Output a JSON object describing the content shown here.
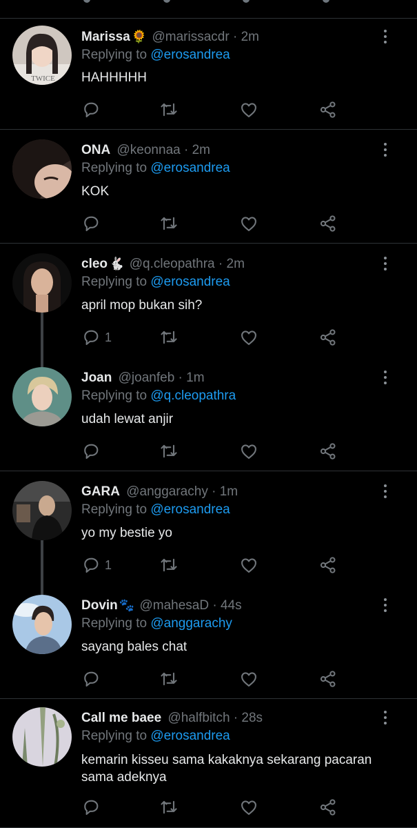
{
  "tweets": [
    {
      "name": "Marissa",
      "emoji": "🌻",
      "handle": "@marissacdr",
      "time": "2m",
      "replying_prefix": "Replying to",
      "replying_to": "@erosandrea",
      "lines": [
        "HAHHHHH"
      ],
      "reply_count": ""
    },
    {
      "name": "ONA",
      "emoji": "",
      "handle": "@keonnaa",
      "time": "2m",
      "replying_prefix": "Replying to",
      "replying_to": "@erosandrea",
      "lines": [
        "KOK"
      ],
      "reply_count": ""
    },
    {
      "name": "cleo",
      "emoji": "🐇",
      "handle": "@q.cleopathra",
      "time": "2m",
      "replying_prefix": "Replying to",
      "replying_to": "@erosandrea",
      "lines": [
        "april mop bukan sih?"
      ],
      "reply_count": "1"
    },
    {
      "name": "Joan",
      "emoji": "",
      "handle": "@joanfeb",
      "time": "1m",
      "replying_prefix": "Replying to",
      "replying_to": "@q.cleopathra",
      "lines": [
        "udah lewat anjir"
      ],
      "reply_count": ""
    },
    {
      "name": "GARA",
      "emoji": "",
      "handle": "@anggarachy",
      "time": "1m",
      "replying_prefix": "Replying to",
      "replying_to": "@erosandrea",
      "lines": [
        "yo my bestie yo"
      ],
      "reply_count": "1"
    },
    {
      "name": "Dovin",
      "emoji": "🐾",
      "handle": "@mahesaD",
      "time": "44s",
      "replying_prefix": "Replying to",
      "replying_to": "@anggarachy",
      "lines": [
        "sayang bales chat"
      ],
      "reply_count": ""
    },
    {
      "name": "Call me baee",
      "emoji": "",
      "handle": "@halfbitch",
      "time": "28s",
      "replying_prefix": "Replying to",
      "replying_to": "@erosandrea",
      "lines": [
        "kemarin kisseu sama kakaknya sekarang pacaran",
        "sama adeknya"
      ],
      "reply_count": ""
    }
  ],
  "separator": "·",
  "colors": {
    "background": "#000000",
    "text": "#e7e9ea",
    "muted": "#71767b",
    "link": "#1d9bf0",
    "divider": "#2f3336"
  },
  "icons": [
    "reply-icon",
    "retweet-icon",
    "like-icon",
    "share-icon",
    "more-options-icon"
  ]
}
